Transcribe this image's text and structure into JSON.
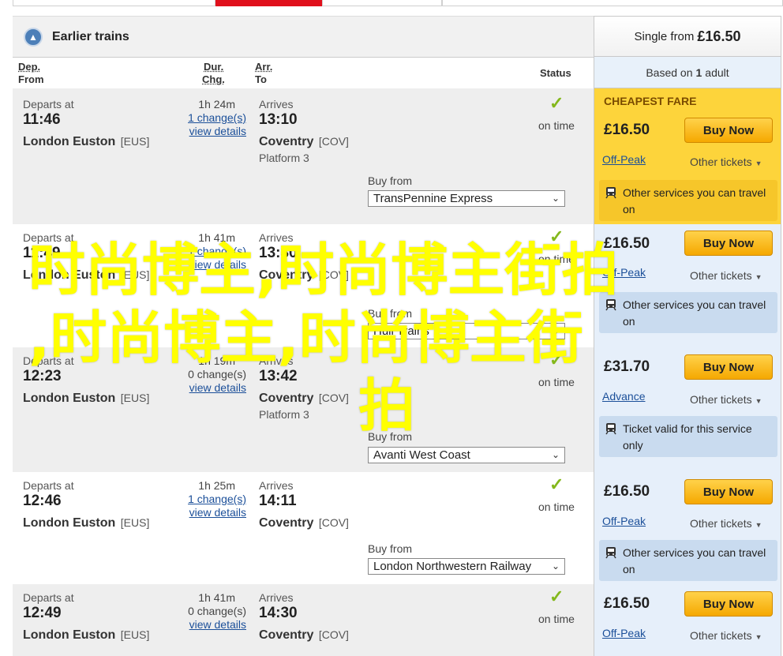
{
  "earlier_trains": {
    "label": "Earlier trains",
    "icon": "arrow-up-icon"
  },
  "fare_header": {
    "prefix": "Single from",
    "price": "£16.50",
    "based_on_prefix": "Based on",
    "adults": "1",
    "based_on_suffix": "adult"
  },
  "columns": {
    "dep_from_1": "Dep.",
    "dep_from_2": "From",
    "dur_chg_1": "Dur.",
    "dur_chg_2": "Chg.",
    "arr_to_1": "Arr.",
    "arr_to_2": "To",
    "status": "Status"
  },
  "colors": {
    "accent_red": "#e0101c",
    "cheapest": "#fdd43b",
    "buy_button": "#f5a800",
    "link": "#1b4f99",
    "on_time_check": "#84b81c",
    "overlay_text": "#ffff00"
  },
  "journeys": [
    {
      "departs_label": "Departs at",
      "dep_time": "11:46",
      "dep_station": "London Euston",
      "dep_code": "[EUS]",
      "duration": "1h 24m",
      "changes": "1 change(s)",
      "details": "view details",
      "arrives_label": "Arrives",
      "arr_time": "13:10",
      "arr_station": "Coventry",
      "arr_code": "[COV]",
      "platform": "Platform 3",
      "status": "on time",
      "buy_from_label": "Buy from",
      "operator": "TransPennine Express",
      "fare": {
        "cheapest_label": "CHEAPEST FARE",
        "price": "£16.50",
        "buy": "Buy Now",
        "type": "Off-Peak",
        "other": "Other tickets",
        "note": "Other services you can travel on"
      }
    },
    {
      "departs_label": "Departs at",
      "dep_time": "11:49",
      "dep_station": "London Euston",
      "dep_code": "[EUS]",
      "duration": "1h 41m",
      "changes": "1 change(s)",
      "details": "view details",
      "arrives_label": "Arrives",
      "arr_time": "13:30",
      "arr_station": "Coventry",
      "arr_code": "[COV]",
      "platform": "",
      "status": "on time",
      "buy_from_label": "Buy from",
      "operator": "Hull Trains",
      "fare": {
        "price": "£16.50",
        "buy": "Buy Now",
        "type": "Off-Peak",
        "other": "Other tickets",
        "note": "Other services you can travel on"
      }
    },
    {
      "departs_label": "Departs at",
      "dep_time": "12:23",
      "dep_station": "London Euston",
      "dep_code": "[EUS]",
      "duration": "1h 19m",
      "changes": "0 change(s)",
      "details": "view details",
      "arrives_label": "Arrives",
      "arr_time": "13:42",
      "arr_station": "Coventry",
      "arr_code": "[COV]",
      "platform": "Platform 3",
      "status": "on time",
      "buy_from_label": "Buy from",
      "operator": "Avanti West Coast",
      "fare": {
        "price": "£31.70",
        "buy": "Buy Now",
        "type": "Advance",
        "other": "Other tickets",
        "note": "Ticket valid for this service only"
      }
    },
    {
      "departs_label": "Departs at",
      "dep_time": "12:46",
      "dep_station": "London Euston",
      "dep_code": "[EUS]",
      "duration": "1h 25m",
      "changes": "1 change(s)",
      "details": "view details",
      "arrives_label": "Arrives",
      "arr_time": "14:11",
      "arr_station": "Coventry",
      "arr_code": "[COV]",
      "platform": "",
      "status": "on time",
      "buy_from_label": "Buy from",
      "operator": "London Northwestern Railway",
      "fare": {
        "price": "£16.50",
        "buy": "Buy Now",
        "type": "Off-Peak",
        "other": "Other tickets",
        "note": "Other services you can travel on"
      }
    },
    {
      "departs_label": "Departs at",
      "dep_time": "12:49",
      "dep_station": "London Euston",
      "dep_code": "[EUS]",
      "duration": "1h 41m",
      "changes": "0 change(s)",
      "details": "view details",
      "arrives_label": "Arrives",
      "arr_time": "14:30",
      "arr_station": "Coventry",
      "arr_code": "[COV]",
      "platform": "",
      "status": "on time",
      "fare": {
        "price": "£16.50",
        "buy": "Buy Now",
        "type": "Off-Peak",
        "other": "Other tickets"
      }
    }
  ],
  "overlay": {
    "line1": "时尚博主,时尚博主街拍",
    "line2": ",时尚博主,时尚博主街",
    "line3": "拍"
  }
}
